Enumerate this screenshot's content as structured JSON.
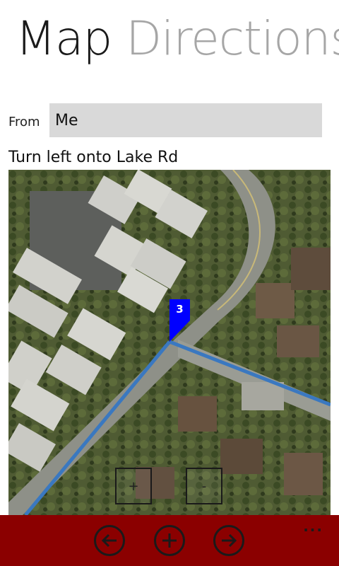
{
  "pivot": {
    "items": [
      {
        "label": "Map",
        "active": true
      },
      {
        "label": "Directions",
        "active": false
      }
    ]
  },
  "from": {
    "label": "From",
    "value": "Me"
  },
  "instruction": "Turn left onto Lake Rd",
  "map": {
    "type": "aerial",
    "waypoint": {
      "label": "3",
      "color": "#0000ff"
    },
    "route_color": "#3a78c0",
    "zoom_in_label": "+",
    "zoom_out_label": "-"
  },
  "app_bar": {
    "color": "#8b0000",
    "buttons": [
      {
        "icon": "arrow-left-icon"
      },
      {
        "icon": "plus-icon"
      },
      {
        "icon": "arrow-right-icon"
      }
    ],
    "more_label": "..."
  }
}
